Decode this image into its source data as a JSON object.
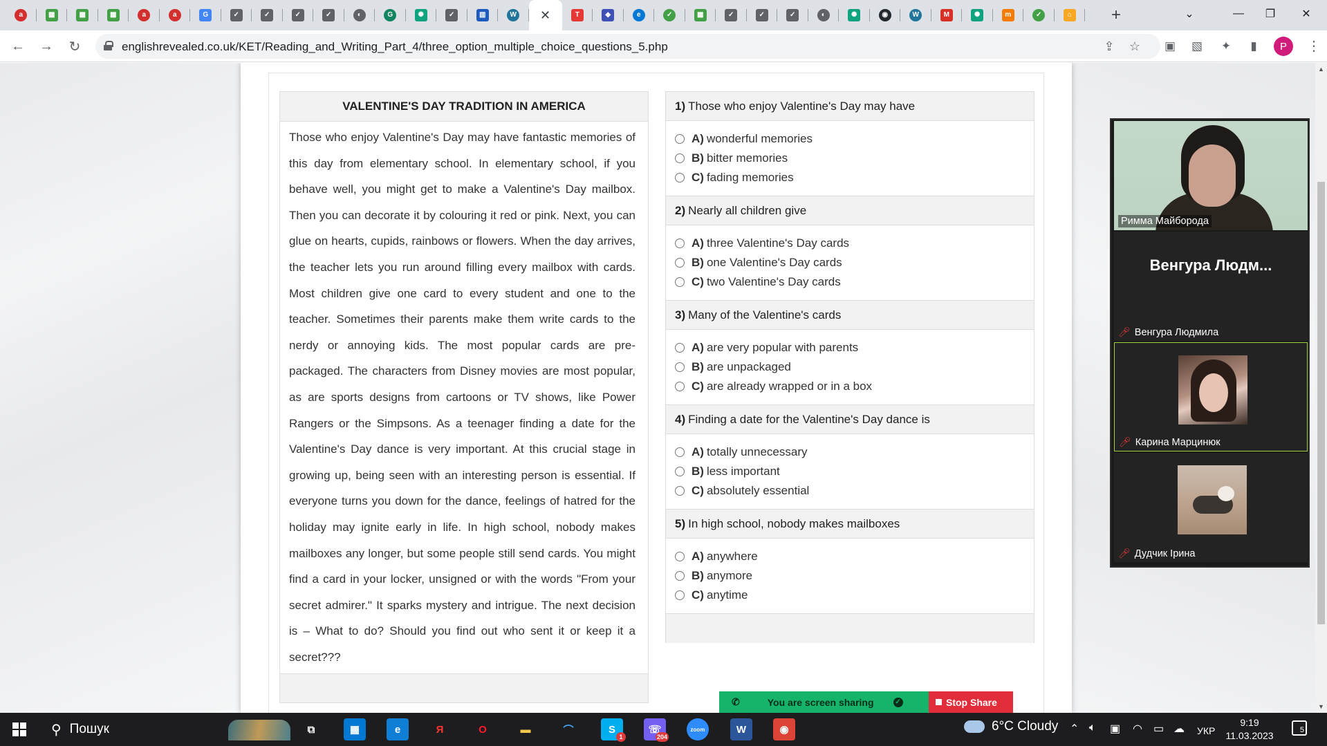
{
  "browser": {
    "tabs": [
      {
        "icon": "ask-icon",
        "color": "#d32f2f",
        "glyph": "a",
        "round": true
      },
      {
        "icon": "grid-icon",
        "color": "#43a047",
        "glyph": "▦"
      },
      {
        "icon": "grid-icon",
        "color": "#43a047",
        "glyph": "▦"
      },
      {
        "icon": "grid-icon",
        "color": "#43a047",
        "glyph": "▦"
      },
      {
        "icon": "ask-icon",
        "color": "#d32f2f",
        "glyph": "a",
        "round": true
      },
      {
        "icon": "ask-icon",
        "color": "#d32f2f",
        "glyph": "a",
        "round": true
      },
      {
        "icon": "translate-icon",
        "color": "#4285f4",
        "glyph": "G"
      },
      {
        "icon": "check-icon",
        "color": "#5f6368",
        "glyph": "✓"
      },
      {
        "icon": "check-icon",
        "color": "#5f6368",
        "glyph": "✓"
      },
      {
        "icon": "check-icon",
        "color": "#5f6368",
        "glyph": "✓"
      },
      {
        "icon": "check-icon",
        "color": "#5f6368",
        "glyph": "✓"
      },
      {
        "icon": "globe-icon",
        "color": "#5f6368",
        "glyph": "◐",
        "round": true
      },
      {
        "icon": "grammarly-icon",
        "color": "#12845f",
        "glyph": "G",
        "round": true
      },
      {
        "icon": "chatgpt-icon",
        "color": "#10a37f",
        "glyph": "✺"
      },
      {
        "icon": "check-icon",
        "color": "#5f6368",
        "glyph": "✓"
      },
      {
        "icon": "flag-icon",
        "color": "#1e5bbf",
        "glyph": "▥"
      },
      {
        "icon": "wordpress-icon",
        "color": "#21759b",
        "glyph": "W",
        "round": true
      },
      {
        "icon": "close-icon",
        "active": true
      },
      {
        "icon": "t-icon",
        "color": "#e53935",
        "glyph": "T"
      },
      {
        "icon": "shield-icon",
        "color": "#3f51b5",
        "glyph": "◆"
      },
      {
        "icon": "edge-icon",
        "color": "#0078d4",
        "glyph": "e",
        "round": true
      },
      {
        "icon": "check-circle-icon",
        "color": "#43a047",
        "glyph": "✓",
        "round": true
      },
      {
        "icon": "grid-icon",
        "color": "#43a047",
        "glyph": "▦"
      },
      {
        "icon": "check-icon",
        "color": "#5f6368",
        "glyph": "✓"
      },
      {
        "icon": "check-icon",
        "color": "#5f6368",
        "glyph": "✓"
      },
      {
        "icon": "check-icon",
        "color": "#5f6368",
        "glyph": "✓"
      },
      {
        "icon": "globe-icon",
        "color": "#5f6368",
        "glyph": "◐",
        "round": true
      },
      {
        "icon": "chatgpt-icon",
        "color": "#10a37f",
        "glyph": "✺"
      },
      {
        "icon": "github-icon",
        "color": "#24292e",
        "glyph": "◉",
        "round": true
      },
      {
        "icon": "wordpress-icon",
        "color": "#21759b",
        "glyph": "W",
        "round": true
      },
      {
        "icon": "gmail-icon",
        "color": "#d93025",
        "glyph": "M"
      },
      {
        "icon": "chatgpt-icon",
        "color": "#10a37f",
        "glyph": "✺"
      },
      {
        "icon": "fm-icon",
        "color": "#f57c00",
        "glyph": "m"
      },
      {
        "icon": "check-circle-icon",
        "color": "#43a047",
        "glyph": "✓",
        "round": true
      },
      {
        "icon": "home-icon",
        "color": "#f9a825",
        "glyph": "⌂"
      }
    ],
    "url": "englishrevealed.co.uk/KET/Reading_and_Writing_Part_4/three_option_multiple_choice_questions_5.php"
  },
  "passage": {
    "title": "VALENTINE'S DAY TRADITION IN AMERICA",
    "text": "Those who enjoy Valentine's Day may have fantastic memories of this day from elementary school. In elementary school, if you behave well, you might get to make a Valentine's Day mailbox. Then you can decorate it by colouring it red or pink. Next, you can glue on hearts, cupids, rainbows or flowers. When the day arrives, the teacher lets you run around filling every mailbox with cards. Most children give one card to every student and one to the teacher. Sometimes their parents make them write cards to the nerdy or annoying kids. The most popular cards are pre-packaged. The characters from Disney movies are most popular, as are sports designs from cartoons or TV shows, like Power Rangers or the Simpsons. As a teenager finding a date for the Valentine's Day dance is very important. At this crucial stage in growing up, being seen with an interesting person is essential. If everyone turns you down for the dance, feelings of hatred for the holiday may ignite early in life. In high school, nobody makes mailboxes any longer, but some people still send cards. You might find a card in your locker, unsigned or with the words \"From your secret admirer.\" It sparks mystery and intrigue. The next decision is – What to do? Should you find out who sent it or keep it a secret???"
  },
  "questions": [
    {
      "num": "1)",
      "text": "Those who enjoy Valentine's Day may have",
      "options": [
        {
          "letter": "A)",
          "text": "wonderful memories"
        },
        {
          "letter": "B)",
          "text": "bitter memories"
        },
        {
          "letter": "C)",
          "text": "fading memories"
        }
      ]
    },
    {
      "num": "2)",
      "text": "Nearly all children give",
      "options": [
        {
          "letter": "A)",
          "text": "three Valentine's Day cards"
        },
        {
          "letter": "B)",
          "text": "one Valentine's Day cards"
        },
        {
          "letter": "C)",
          "text": "two Valentine's Day cards"
        }
      ]
    },
    {
      "num": "3)",
      "text": "Many of the Valentine's cards",
      "options": [
        {
          "letter": "A)",
          "text": "are very popular with parents"
        },
        {
          "letter": "B)",
          "text": "are unpackaged"
        },
        {
          "letter": "C)",
          "text": "are already wrapped or in a box"
        }
      ]
    },
    {
      "num": "4)",
      "text": "Finding a date for the Valentine's Day dance is",
      "options": [
        {
          "letter": "A)",
          "text": "totally unnecessary"
        },
        {
          "letter": "B)",
          "text": "less important"
        },
        {
          "letter": "C)",
          "text": "absolutely essential"
        }
      ]
    },
    {
      "num": "5)",
      "text": "In high school, nobody makes mailboxes",
      "options": [
        {
          "letter": "A)",
          "text": "anywhere"
        },
        {
          "letter": "B)",
          "text": "anymore"
        },
        {
          "letter": "C)",
          "text": "anytime"
        }
      ]
    }
  ],
  "zoom": {
    "participants": [
      {
        "name": "Римма Майборода",
        "muted": false
      },
      {
        "name": "Венгура Людмила",
        "display": "Венгура Людм...",
        "muted": true
      },
      {
        "name": "Карина Марцинюк",
        "muted": true,
        "active_speaker": true
      },
      {
        "name": "Дудчик Ірина",
        "muted": true
      }
    ],
    "share_status": "You are screen sharing",
    "stop_share": "Stop Share"
  },
  "taskbar": {
    "search_placeholder": "Пошук",
    "apps": [
      {
        "name": "task-view",
        "glyph": "⧉",
        "color": "transparent"
      },
      {
        "name": "store",
        "glyph": "▦",
        "color": "#0078d4"
      },
      {
        "name": "edge",
        "glyph": "e",
        "color": "#0f7fd6"
      },
      {
        "name": "yandex",
        "glyph": "Я",
        "color": "transparent",
        "text_color": "#ff3333"
      },
      {
        "name": "opera",
        "glyph": "O",
        "color": "transparent",
        "text_color": "#ff1b2d"
      },
      {
        "name": "file-explorer",
        "glyph": "▬",
        "color": "transparent",
        "text_color": "#f2c94c"
      },
      {
        "name": "app-arc",
        "glyph": "⌒",
        "color": "transparent",
        "text_color": "#44aaff"
      },
      {
        "name": "skype",
        "glyph": "S",
        "color": "#00aff0",
        "badge": "1"
      },
      {
        "name": "viber",
        "glyph": "☏",
        "color": "#7360f2",
        "badge": "204"
      },
      {
        "name": "zoom",
        "glyph": "zoom",
        "color": "#2d8cff"
      },
      {
        "name": "word",
        "glyph": "W",
        "color": "#2b579a"
      },
      {
        "name": "chrome",
        "glyph": "◉",
        "color": "#db4437",
        "active": true
      }
    ],
    "weather": "6°C  Cloudy",
    "language": "УКР",
    "time": "9:19",
    "date": "11.03.2023",
    "notifications": "5"
  }
}
